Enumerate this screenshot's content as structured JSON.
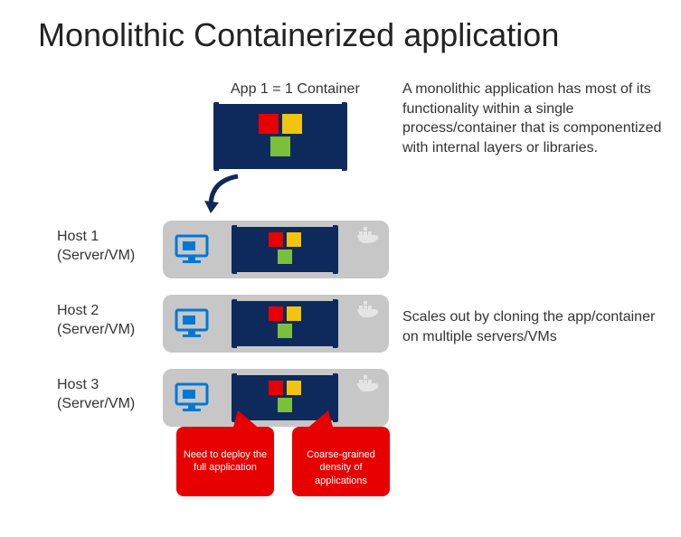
{
  "title": "Monolithic Containerized application",
  "app_label": "App 1 = 1 Container",
  "description_top": "A monolithic application has most of its functionality within a single  process/container that is componentized with internal layers or libraries.",
  "description_scale": "Scales out by cloning the app/container on multiple servers/VMs",
  "hosts": [
    {
      "label_line1": "Host 1",
      "label_line2": "(Server/VM)"
    },
    {
      "label_line1": "Host 2",
      "label_line2": "(Server/VM)"
    },
    {
      "label_line1": "Host 3",
      "label_line2": "(Server/VM)"
    }
  ],
  "callouts": {
    "deploy": "Need to deploy the full application",
    "density": "Coarse-grained density of applications"
  },
  "colors": {
    "container_bg": "#0e2a5c",
    "tile_red": "#e60000",
    "tile_yellow": "#f1c40f",
    "tile_green": "#7cbf3a",
    "host_bg": "#c7c7c7",
    "callout_bg": "#e60000",
    "monitor_color": "#0078d4"
  },
  "icons": {
    "monitor": "monitor-icon",
    "docker": "docker-whale-icon",
    "arrow": "curved-arrow-icon"
  }
}
